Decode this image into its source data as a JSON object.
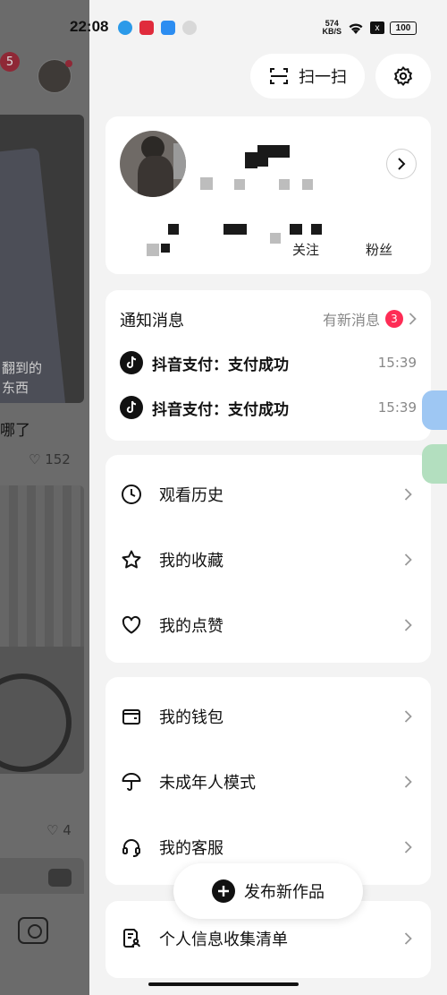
{
  "status_bar": {
    "time": "22:08",
    "net_speed_value": "574",
    "net_speed_unit": "KB/S",
    "sim_label": "x",
    "battery": "100"
  },
  "background": {
    "notification_badge": "5",
    "card_caption_line1": "翻到的",
    "card_caption_line2": "东西",
    "post_title": "哪了",
    "likes_1": "152",
    "likes_2": "4"
  },
  "top_actions": {
    "scan_label": "扫一扫"
  },
  "profile": {
    "stats": [
      {
        "label": ""
      },
      {
        "label": ""
      },
      {
        "label": "关注"
      },
      {
        "label": "粉丝"
      }
    ]
  },
  "notifications": {
    "title": "通知消息",
    "new_label": "有新消息",
    "new_count": "3",
    "items": [
      {
        "text": "抖音支付：支付成功",
        "time": "15:39"
      },
      {
        "text": "抖音支付：支付成功",
        "time": "15:39"
      }
    ]
  },
  "menu_group_1": [
    {
      "label": "观看历史",
      "icon": "clock-icon"
    },
    {
      "label": "我的收藏",
      "icon": "star-icon"
    },
    {
      "label": "我的点赞",
      "icon": "heart-icon"
    }
  ],
  "menu_group_2": [
    {
      "label": "我的钱包",
      "icon": "wallet-icon"
    },
    {
      "label": "未成年人模式",
      "icon": "umbrella-icon"
    },
    {
      "label": "我的客服",
      "icon": "headset-icon"
    }
  ],
  "menu_group_3": [
    {
      "label": "个人信息收集清单",
      "icon": "document-user-icon"
    }
  ],
  "publish": {
    "label": "发布新作品"
  }
}
